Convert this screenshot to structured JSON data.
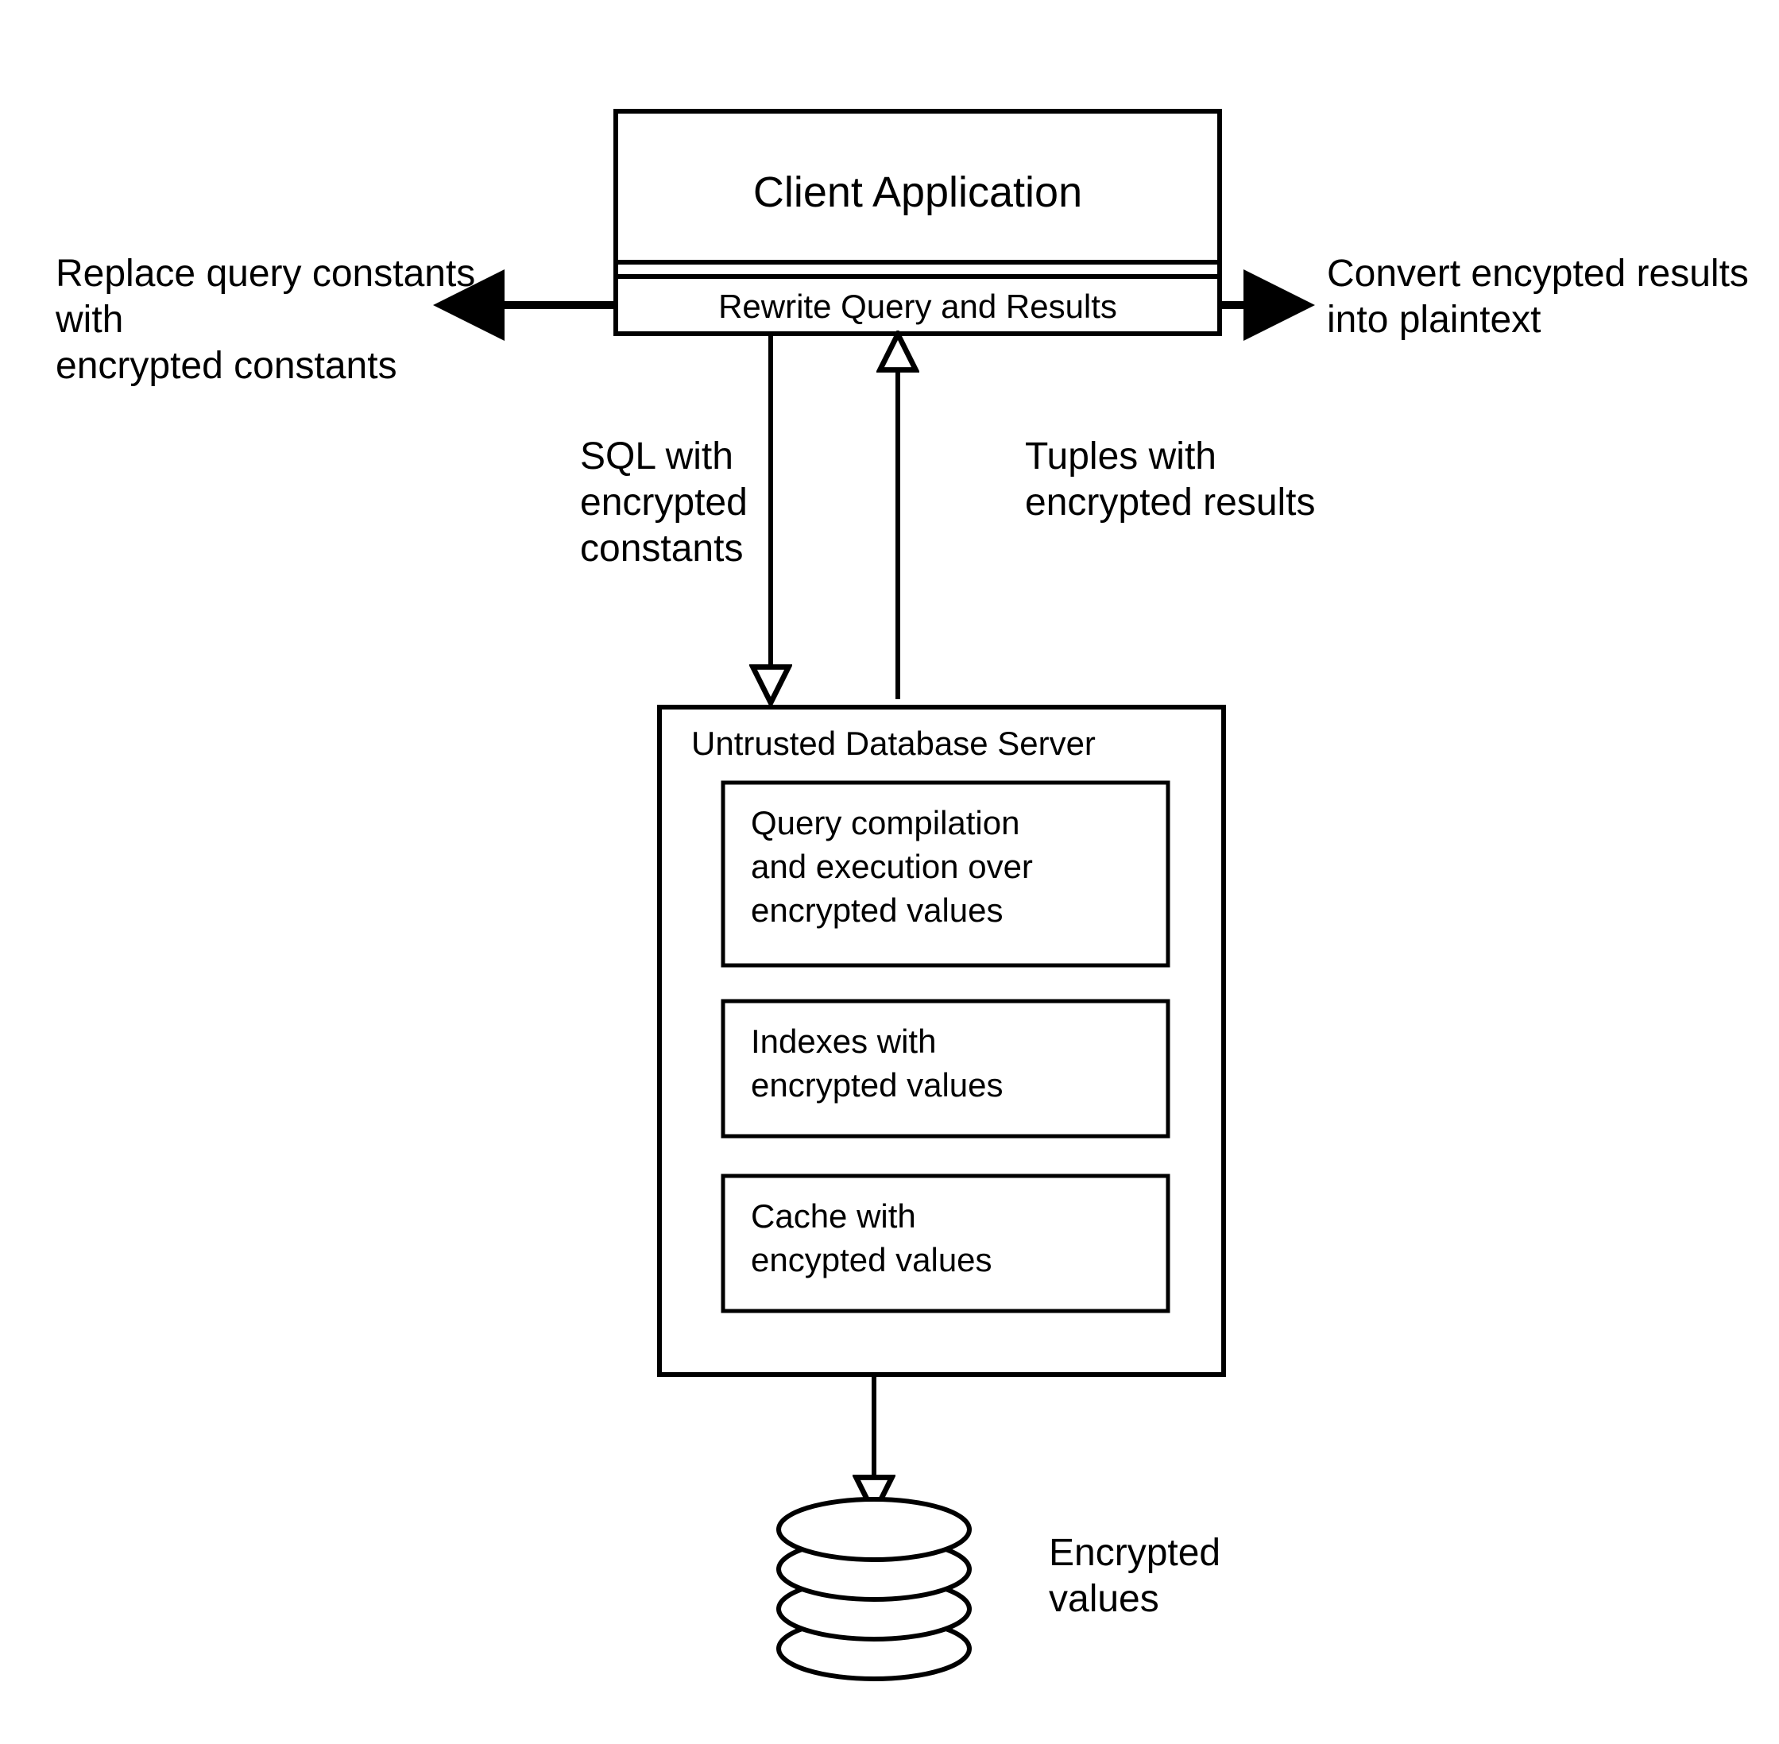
{
  "client_box": {
    "title": "Client Application",
    "sub": "Rewrite Query and Results"
  },
  "left_annot": {
    "l1": "Replace query constants",
    "l2": "with",
    "l3": "encrypted constants"
  },
  "right_annot": {
    "l1": "Convert encypted results",
    "l2": "into plaintext"
  },
  "flow_down": {
    "l1": "SQL with",
    "l2": "encrypted",
    "l3": "constants"
  },
  "flow_up": {
    "l1": "Tuples with",
    "l2": "encrypted results"
  },
  "server": {
    "title": "Untrusted Database Server",
    "box1": {
      "l1": "Query compilation",
      "l2": "and execution over",
      "l3": "encrypted values"
    },
    "box2": {
      "l1": "Indexes with",
      "l2": "encrypted values"
    },
    "box3": {
      "l1": "Cache with",
      "l2": "encypted values"
    }
  },
  "storage": {
    "l1": "Encrypted",
    "l2": "values"
  }
}
